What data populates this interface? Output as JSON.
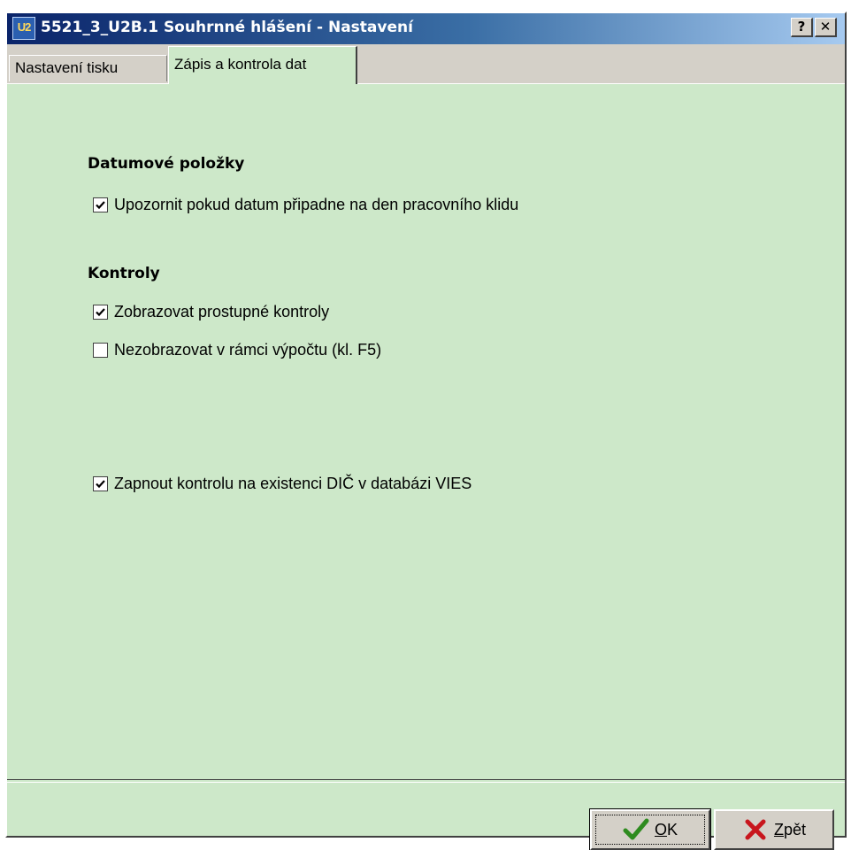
{
  "window": {
    "title": "5521_3_U2B.1 Souhrnné hlášení - Nastavení",
    "app_icon_text": "U2",
    "help_button": "?",
    "close_button": "✕"
  },
  "tabs": [
    {
      "label": "Nastavení tisku",
      "active": false
    },
    {
      "label": "Zápis a kontrola dat",
      "active": true
    }
  ],
  "sections": {
    "dates": {
      "heading": "Datumové položky",
      "items": [
        {
          "label": "Upozornit pokud datum připadne na den pracovního klidu",
          "checked": true
        }
      ]
    },
    "checks": {
      "heading": "Kontroly",
      "items": [
        {
          "label": "Zobrazovat prostupné kontroly",
          "checked": true
        },
        {
          "label": "Nezobrazovat v rámci výpočtu (kl. F5)",
          "checked": false
        }
      ]
    },
    "vies": {
      "items": [
        {
          "label": "Zapnout kontrolu na existenci DIČ v databázi VIES",
          "checked": true
        }
      ]
    }
  },
  "buttons": {
    "ok_label": "OK",
    "back_label": "Zpět"
  },
  "colors": {
    "panel_bg": "#cde8c9",
    "title_gradient_start": "#0a246a",
    "title_gradient_end": "#a6caf0",
    "ok_check": "#2e8b1f",
    "back_cross": "#c8161d"
  }
}
